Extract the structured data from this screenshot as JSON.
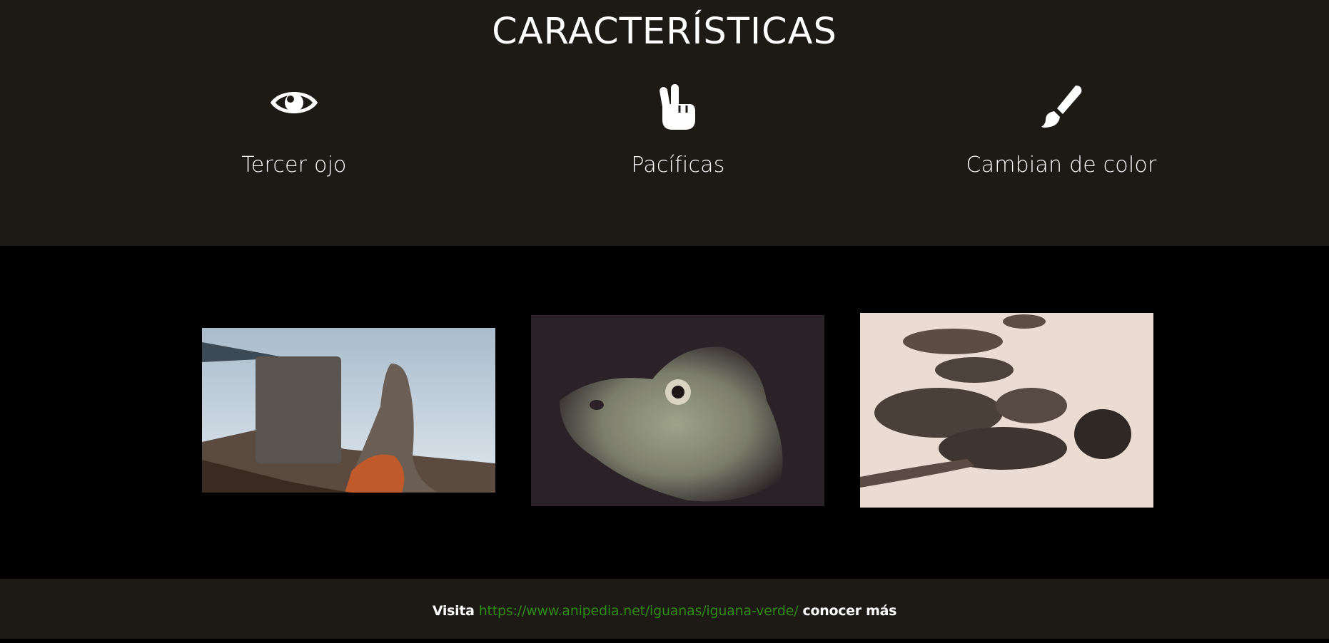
{
  "features": {
    "title": "CARACTERÍSTICAS",
    "items": [
      {
        "icon": "eye-icon",
        "label": "Tercer ojo"
      },
      {
        "icon": "peace-hand-icon",
        "label": "Pacíficas"
      },
      {
        "icon": "paint-brush-icon",
        "label": "Cambian de color"
      }
    ]
  },
  "gallery": {
    "photos": [
      {
        "name": "iguana-by-water-photo"
      },
      {
        "name": "iguana-head-closeup-photo"
      },
      {
        "name": "iguanas-on-sand-photo"
      }
    ]
  },
  "footer": {
    "prefix": "Visita",
    "link": "https://www.anipedia.net/iguanas/iguana-verde/",
    "suffix": "conocer más",
    "link_color": "#2e8b12"
  },
  "colors": {
    "section_bg": "#1d1915",
    "gallery_bg": "#000000",
    "text": "#ffffff"
  }
}
